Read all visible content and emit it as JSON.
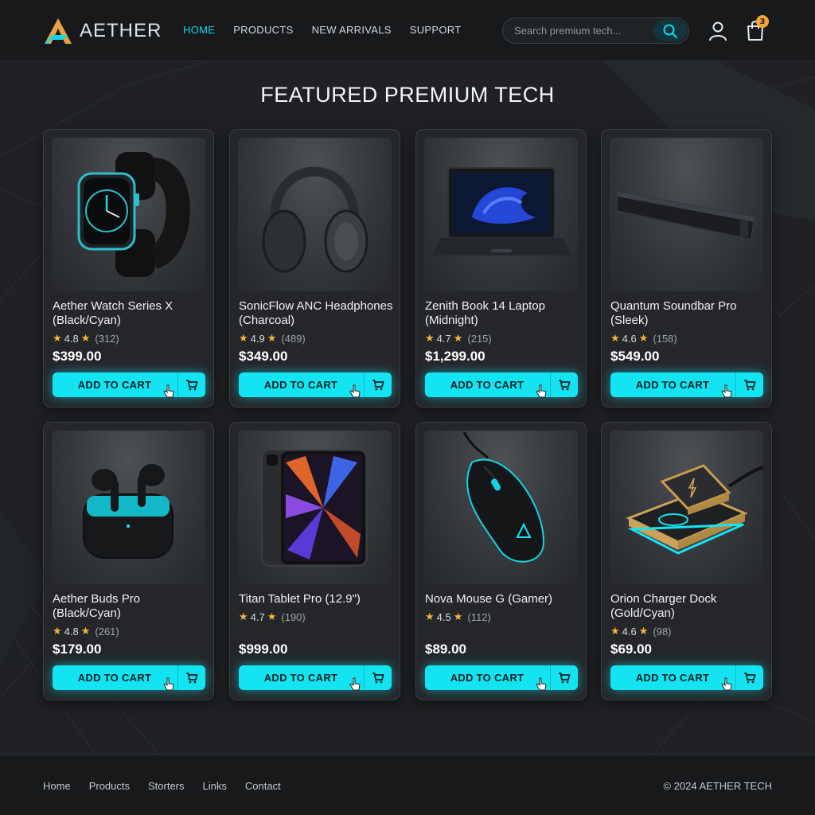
{
  "brand": {
    "name": "AETHER"
  },
  "nav": {
    "items": [
      "HOME",
      "PRODUCTS",
      "NEW ARRIVALS",
      "SUPPORT"
    ],
    "active": "HOME"
  },
  "search": {
    "placeholder": "Search premium tech..."
  },
  "cart": {
    "count": "3"
  },
  "main": {
    "title": "FEATURED PREMIUM TECH"
  },
  "products": [
    {
      "name": "Aether Watch Series X (Black/Cyan)",
      "rating": "4.8",
      "reviews": "(312)",
      "price": "$399.00",
      "button": "ADD TO CART",
      "image": "smartwatch"
    },
    {
      "name": "SonicFlow ANC Headphones (Charcoal)",
      "rating": "4.9",
      "reviews": "(489)",
      "price": "$349.00",
      "button": "ADD TO CART",
      "image": "headphones"
    },
    {
      "name": "Zenith Book 14 Laptop (Midnight)",
      "rating": "4.7",
      "reviews": "(215)",
      "price": "$1,299.00",
      "button": "ADD TO CART",
      "image": "laptop"
    },
    {
      "name": "Quantum Soundbar Pro (Sleek)",
      "rating": "4.6",
      "reviews": "(158)",
      "price": "$549.00",
      "button": "ADD TO CART",
      "image": "soundbar"
    },
    {
      "name": "Aether Buds Pro (Black/Cyan)",
      "rating": "4.8",
      "reviews": "(261)",
      "price": "$179.00",
      "button": "ADD TO CART",
      "image": "earbuds"
    },
    {
      "name": "Titan Tablet Pro (12.9\")",
      "rating": "4.7",
      "reviews": "(190)",
      "price": "$999.00",
      "button": "ADD TO CART",
      "image": "tablet"
    },
    {
      "name": "Nova Mouse G (Gamer)",
      "rating": "4.5",
      "reviews": "(112)",
      "price": "$89.00",
      "button": "ADD TO CART",
      "image": "mouse"
    },
    {
      "name": "Orion Charger Dock (Gold/Cyan)",
      "rating": "4.6",
      "reviews": "(98)",
      "price": "$69.00",
      "button": "ADD TO CART",
      "image": "charger-dock"
    }
  ],
  "footer": {
    "links": [
      "Home",
      "Products",
      "Storters",
      "Links",
      "Contact"
    ],
    "copyright": "© 2024 AETHER TECH"
  },
  "colors": {
    "accent": "#14e4f2",
    "nav_active": "#19d5ea",
    "star": "#f4b63a",
    "badge": "#f2a63a",
    "background": "#1f2124"
  }
}
